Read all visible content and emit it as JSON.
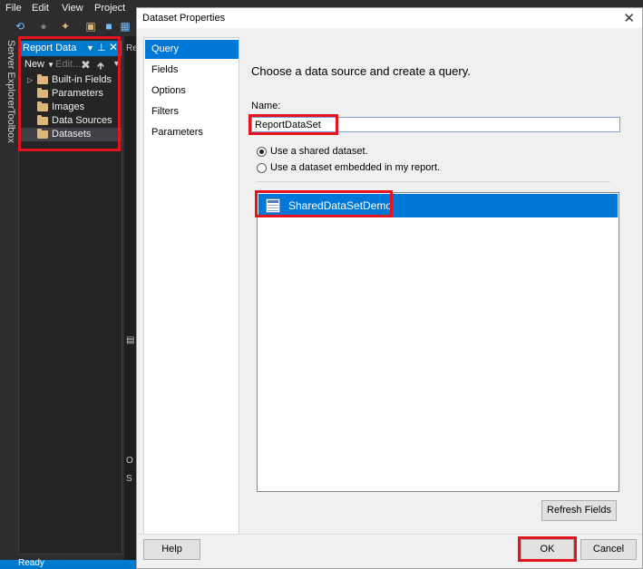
{
  "menubar": {
    "items": [
      "File",
      "Edit",
      "View",
      "Project"
    ]
  },
  "side_tabs": {
    "server_explorer": "Server Explorer",
    "toolbox": "Toolbox"
  },
  "report_data": {
    "title": "Report Data",
    "new_label": "New",
    "edit_label": "Edit...",
    "items": [
      {
        "label": "Built-in Fields",
        "expandable": true
      },
      {
        "label": "Parameters",
        "expandable": false
      },
      {
        "label": "Images",
        "expandable": false
      },
      {
        "label": "Data Sources",
        "expandable": false
      },
      {
        "label": "Datasets",
        "expandable": false,
        "selected": true
      }
    ]
  },
  "editor_strip": {
    "tab": "Re",
    "pane": "O",
    "sub": "S"
  },
  "statusbar": {
    "text": "Ready"
  },
  "dialog": {
    "title": "Dataset Properties",
    "nav": [
      "Query",
      "Fields",
      "Options",
      "Filters",
      "Parameters"
    ],
    "active_nav": "Query",
    "heading": "Choose a data source and create a query.",
    "name_label": "Name:",
    "name_value": "ReportDataSet",
    "radio_shared": "Use a shared dataset.",
    "radio_embedded": "Use a dataset embedded in my report.",
    "datasets": [
      "SharedDataSetDemo"
    ],
    "refresh_label": "Refresh Fields",
    "help_label": "Help",
    "ok_label": "OK",
    "cancel_label": "Cancel"
  },
  "colors": {
    "accent": "#007acc",
    "selection": "#0078d7",
    "highlight": "#e3141e"
  }
}
